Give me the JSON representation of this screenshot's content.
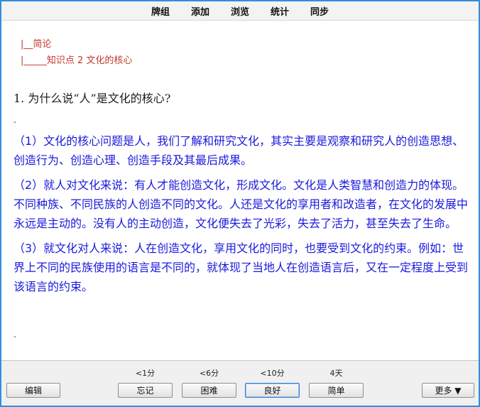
{
  "menu": {
    "items": [
      "牌组",
      "添加",
      "浏览",
      "统计",
      "同步"
    ]
  },
  "breadcrumb": {
    "line1": "|__简论",
    "line2": "|_____知识点 2 文化的核心"
  },
  "question": "1. 为什么说“人”是文化的核心?",
  "separator": "-",
  "answer": {
    "paragraphs": [
      "（1）文化的核心问题是人，我们了解和研究文化，其实主要是观察和研究人的创造思想、创造行为、创造心理、创造手段及其最后成果。",
      "（2）就人对文化来说：有人才能创造文化，形成文化。文化是人类智慧和创造力的体现。不同种族、不同民族的人创造不同的文化。人还是文化的享用者和改造者，在文化的发展中永远是主动的。没有人的主动创造，文化便失去了光彩，失去了活力，甚至失去了生命。",
      "（3）就文化对人来说：人在创造文化，享用文化的同时，也要受到文化的约束。例如：世界上不同的民族使用的语言是不同的，就体现了当地人在创造语言后，又在一定程度上受到该语言的约束。"
    ]
  },
  "bottom": {
    "edit_label": "编辑",
    "more_label": "更多 ▼",
    "answers": [
      {
        "interval": "<1分",
        "label": "忘记"
      },
      {
        "interval": "<6分",
        "label": "困难"
      },
      {
        "interval": "<10分",
        "label": "良好"
      },
      {
        "interval": "4天",
        "label": "简单"
      }
    ]
  },
  "colors": {
    "window_border": "#2f8fe0",
    "breadcrumb": "#c0392b",
    "answer_text": "#1a1adc"
  }
}
